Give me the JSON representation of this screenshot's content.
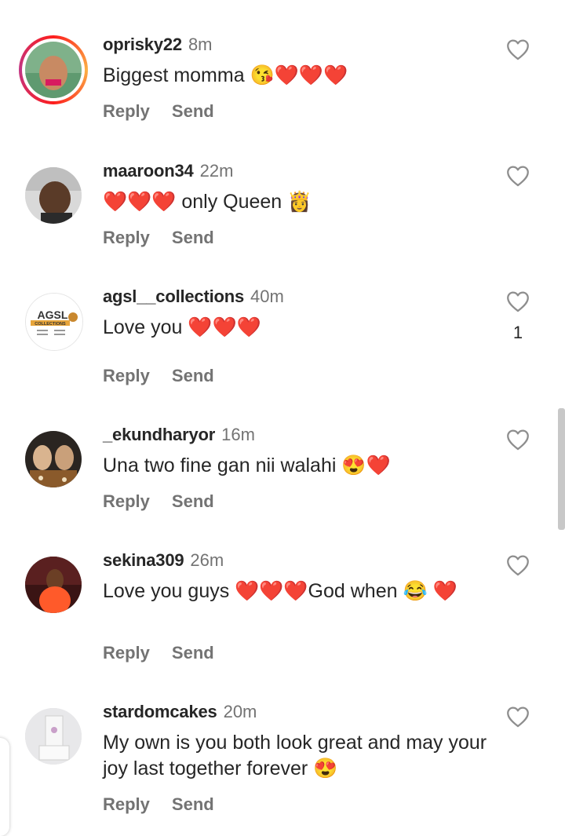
{
  "comments": [
    {
      "username": "oprisky22",
      "time": "8m",
      "text": "Biggest momma 😘❤️❤️❤️",
      "reply": "Reply",
      "send": "Send",
      "likes": ""
    },
    {
      "username": "maaroon34",
      "time": "22m",
      "text": "❤️❤️❤️ only Queen 👸",
      "reply": "Reply",
      "send": "Send",
      "likes": ""
    },
    {
      "username": "agsl__collections",
      "time": "40m",
      "text": "Love you ❤️❤️❤️",
      "reply": "Reply",
      "send": "Send",
      "likes": "1"
    },
    {
      "username": "_ekundharyor",
      "time": "16m",
      "text": "Una two fine gan nii walahi 😍❤️",
      "reply": "Reply",
      "send": "Send",
      "likes": ""
    },
    {
      "username": "sekina309",
      "time": "26m",
      "text": "Love you guys ❤️❤️❤️God when 😂 ❤️",
      "reply": "Reply",
      "send": "Send",
      "likes": ""
    },
    {
      "username": "stardomcakes",
      "time": "20m",
      "text": "My own is you both look great and may your joy last together forever 😍",
      "reply": "Reply",
      "send": "Send",
      "likes": ""
    }
  ],
  "avatar_logo_text": "AGSL COLLECTIONS",
  "colors": {
    "text": "#262626",
    "secondary": "#737373",
    "heart_outline": "#8e8e8e",
    "story_ring": [
      "#fd1d1d",
      "#fcb045",
      "#c13584"
    ]
  }
}
